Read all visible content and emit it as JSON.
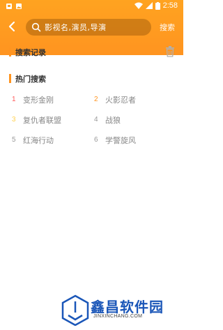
{
  "status_bar": {
    "time": "2:58"
  },
  "header": {
    "search_placeholder": "影视名,演员,导演",
    "search_button": "搜索"
  },
  "history": {
    "title": "搜索记录"
  },
  "hot": {
    "title": "热门搜索",
    "items": [
      {
        "num": "1",
        "label": "变形金刚",
        "color": "#ff5a5a"
      },
      {
        "num": "2",
        "label": "火影忍者",
        "color": "#ff9420"
      },
      {
        "num": "3",
        "label": "复仇者联盟",
        "color": "#ffd050"
      },
      {
        "num": "4",
        "label": "战狼",
        "color": "#999999"
      },
      {
        "num": "5",
        "label": "红海行动",
        "color": "#999999"
      },
      {
        "num": "6",
        "label": "学警旋风",
        "color": "#999999"
      }
    ]
  },
  "watermark": {
    "title": "鑫昌软件园",
    "subtitle": "JINXINCHANG.COM"
  },
  "colors": {
    "accent": "#ff9420",
    "watermark_blue": "#1a56b8"
  }
}
